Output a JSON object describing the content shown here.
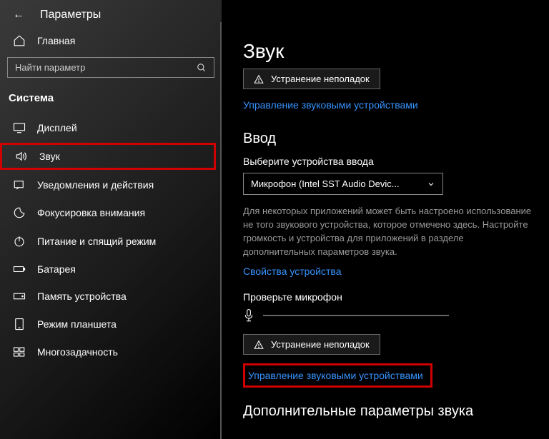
{
  "header": {
    "title": "Параметры"
  },
  "home": {
    "label": "Главная"
  },
  "search": {
    "placeholder": "Найти параметр"
  },
  "section": {
    "label": "Система"
  },
  "nav": {
    "display": "Дисплей",
    "sound": "Звук",
    "notifications": "Уведомления и действия",
    "focus": "Фокусировка внимания",
    "power": "Питание и спящий режим",
    "battery": "Батарея",
    "storage": "Память устройства",
    "tablet": "Режим планшета",
    "multitask": "Многозадачность"
  },
  "main": {
    "title": "Звук",
    "troubleshoot1": "Устранение неполадок",
    "manage1": "Управление звуковыми устройствами",
    "input_h": "Ввод",
    "input_label": "Выберите устройства ввода",
    "input_sel": "Микрофон (Intel SST Audio Devic...",
    "input_desc": "Для некоторых приложений может быть настроено использование не того звукового устройства, которое отмечено здесь. Настройте громкость и устройства для приложений в разделе дополнительных параметров звука.",
    "device_props": "Свойства устройства",
    "test_mic": "Проверьте микрофон",
    "troubleshoot2": "Устранение неполадок",
    "manage2": "Управление звуковыми устройствами",
    "extra_h": "Дополнительные параметры звука"
  }
}
